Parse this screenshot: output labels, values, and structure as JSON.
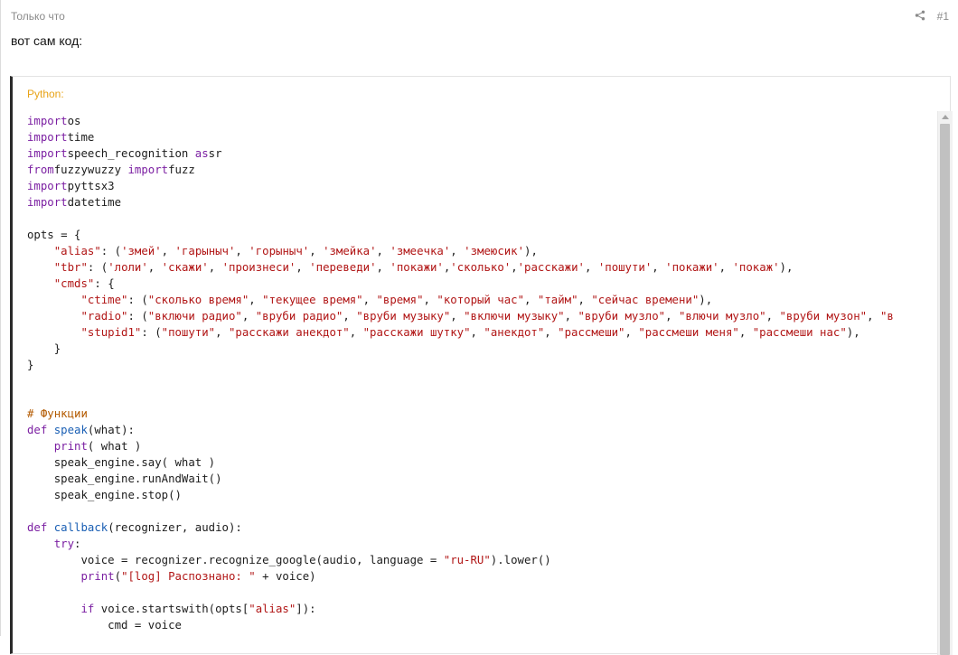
{
  "post": {
    "timestamp": "Только что",
    "number": "#1",
    "message": "вот сам код:"
  },
  "code_block": {
    "language_label": "Python:",
    "lines": [
      [
        [
          "kw",
          "import"
        ],
        [
          "",
          "os"
        ]
      ],
      [
        [
          "kw",
          "import"
        ],
        [
          "",
          "time"
        ]
      ],
      [
        [
          "kw",
          "import"
        ],
        [
          "",
          "speech_recognition "
        ],
        [
          "kw",
          "as"
        ],
        [
          "",
          "sr"
        ]
      ],
      [
        [
          "kw",
          "from"
        ],
        [
          "",
          "fuzzywuzzy "
        ],
        [
          "kw",
          "import"
        ],
        [
          "",
          "fuzz"
        ]
      ],
      [
        [
          "kw",
          "import"
        ],
        [
          "",
          "pyttsx3"
        ]
      ],
      [
        [
          "kw",
          "import"
        ],
        [
          "",
          "datetime"
        ]
      ],
      [],
      [
        [
          "",
          "opts = {"
        ]
      ],
      [
        [
          "",
          "    "
        ],
        [
          "st",
          "\"alias\""
        ],
        [
          "",
          ": ("
        ],
        [
          "st",
          "'змей'"
        ],
        [
          "",
          ", "
        ],
        [
          "st",
          "'гарыныч'"
        ],
        [
          "",
          ", "
        ],
        [
          "st",
          "'горыныч'"
        ],
        [
          "",
          ", "
        ],
        [
          "st",
          "'змейка'"
        ],
        [
          "",
          ", "
        ],
        [
          "st",
          "'змеечка'"
        ],
        [
          "",
          ", "
        ],
        [
          "st",
          "'змеюсик'"
        ],
        [
          "",
          "),"
        ]
      ],
      [
        [
          "",
          "    "
        ],
        [
          "st",
          "\"tbr\""
        ],
        [
          "",
          ": ("
        ],
        [
          "st",
          "'лоли'"
        ],
        [
          "",
          ", "
        ],
        [
          "st",
          "'скажи'"
        ],
        [
          "",
          ", "
        ],
        [
          "st",
          "'произнеси'"
        ],
        [
          "",
          ", "
        ],
        [
          "st",
          "'переведи'"
        ],
        [
          "",
          ", "
        ],
        [
          "st",
          "'покажи'"
        ],
        [
          "",
          ","
        ],
        [
          "st",
          "'сколько'"
        ],
        [
          "",
          ","
        ],
        [
          "st",
          "'расскажи'"
        ],
        [
          "",
          ", "
        ],
        [
          "st",
          "'пошути'"
        ],
        [
          "",
          ", "
        ],
        [
          "st",
          "'покажи'"
        ],
        [
          "",
          ", "
        ],
        [
          "st",
          "'покаж'"
        ],
        [
          "",
          "),"
        ]
      ],
      [
        [
          "",
          "    "
        ],
        [
          "st",
          "\"cmds\""
        ],
        [
          "",
          ": {"
        ]
      ],
      [
        [
          "",
          "        "
        ],
        [
          "st",
          "\"ctime\""
        ],
        [
          "",
          ": ("
        ],
        [
          "st",
          "\"сколько время\""
        ],
        [
          "",
          ", "
        ],
        [
          "st",
          "\"текущее время\""
        ],
        [
          "",
          ", "
        ],
        [
          "st",
          "\"время\""
        ],
        [
          "",
          ", "
        ],
        [
          "st",
          "\"который час\""
        ],
        [
          "",
          ", "
        ],
        [
          "st",
          "\"тайм\""
        ],
        [
          "",
          ", "
        ],
        [
          "st",
          "\"сейчас времени\""
        ],
        [
          "",
          "),"
        ]
      ],
      [
        [
          "",
          "        "
        ],
        [
          "st",
          "\"radio\""
        ],
        [
          "",
          ": ("
        ],
        [
          "st",
          "\"включи радио\""
        ],
        [
          "",
          ", "
        ],
        [
          "st",
          "\"вруби радио\""
        ],
        [
          "",
          ", "
        ],
        [
          "st",
          "\"вруби музыку\""
        ],
        [
          "",
          ", "
        ],
        [
          "st",
          "\"включи музыку\""
        ],
        [
          "",
          ", "
        ],
        [
          "st",
          "\"вруби музло\""
        ],
        [
          "",
          ", "
        ],
        [
          "st",
          "\"влючи музло\""
        ],
        [
          "",
          ", "
        ],
        [
          "st",
          "\"вруби музон\""
        ],
        [
          "",
          ", "
        ],
        [
          "st",
          "\"в"
        ]
      ],
      [
        [
          "",
          "        "
        ],
        [
          "st",
          "\"stupid1\""
        ],
        [
          "",
          ": ("
        ],
        [
          "st",
          "\"пошути\""
        ],
        [
          "",
          ", "
        ],
        [
          "st",
          "\"расскажи анекдот\""
        ],
        [
          "",
          ", "
        ],
        [
          "st",
          "\"расскажи шутку\""
        ],
        [
          "",
          ", "
        ],
        [
          "st",
          "\"анекдот\""
        ],
        [
          "",
          ", "
        ],
        [
          "st",
          "\"рассмеши\""
        ],
        [
          "",
          ", "
        ],
        [
          "st",
          "\"рассмеши меня\""
        ],
        [
          "",
          ", "
        ],
        [
          "st",
          "\"рассмеши нас\""
        ],
        [
          "",
          "),"
        ]
      ],
      [
        [
          "",
          "    }"
        ]
      ],
      [
        [
          "",
          "}"
        ]
      ],
      [],
      [],
      [
        [
          "cm",
          "# Функции"
        ]
      ],
      [
        [
          "kw",
          "def"
        ],
        [
          "",
          " "
        ],
        [
          "fn",
          "speak"
        ],
        [
          "",
          "(what):"
        ]
      ],
      [
        [
          "",
          "    "
        ],
        [
          "kw",
          "print"
        ],
        [
          "",
          "( what )"
        ]
      ],
      [
        [
          "",
          "    speak_engine.say( what )"
        ]
      ],
      [
        [
          "",
          "    speak_engine.runAndWait()"
        ]
      ],
      [
        [
          "",
          "    speak_engine.stop()"
        ]
      ],
      [],
      [
        [
          "kw",
          "def"
        ],
        [
          "",
          " "
        ],
        [
          "fn",
          "callback"
        ],
        [
          "",
          "(recognizer, audio):"
        ]
      ],
      [
        [
          "",
          "    "
        ],
        [
          "kw",
          "try"
        ],
        [
          "",
          ":"
        ]
      ],
      [
        [
          "",
          "        voice = recognizer.recognize_google(audio, language = "
        ],
        [
          "st",
          "\"ru-RU\""
        ],
        [
          "",
          ").lower()"
        ]
      ],
      [
        [
          "",
          "        "
        ],
        [
          "kw",
          "print"
        ],
        [
          "",
          "("
        ],
        [
          "st",
          "\"[log] Распознано: \""
        ],
        [
          "",
          " + voice)"
        ]
      ],
      [],
      [
        [
          "",
          "        "
        ],
        [
          "kw",
          "if"
        ],
        [
          "",
          " voice.startswith(opts["
        ],
        [
          "st",
          "\"alias\""
        ],
        [
          "",
          "]):"
        ]
      ],
      [
        [
          "",
          "            cmd = voice"
        ]
      ]
    ]
  }
}
